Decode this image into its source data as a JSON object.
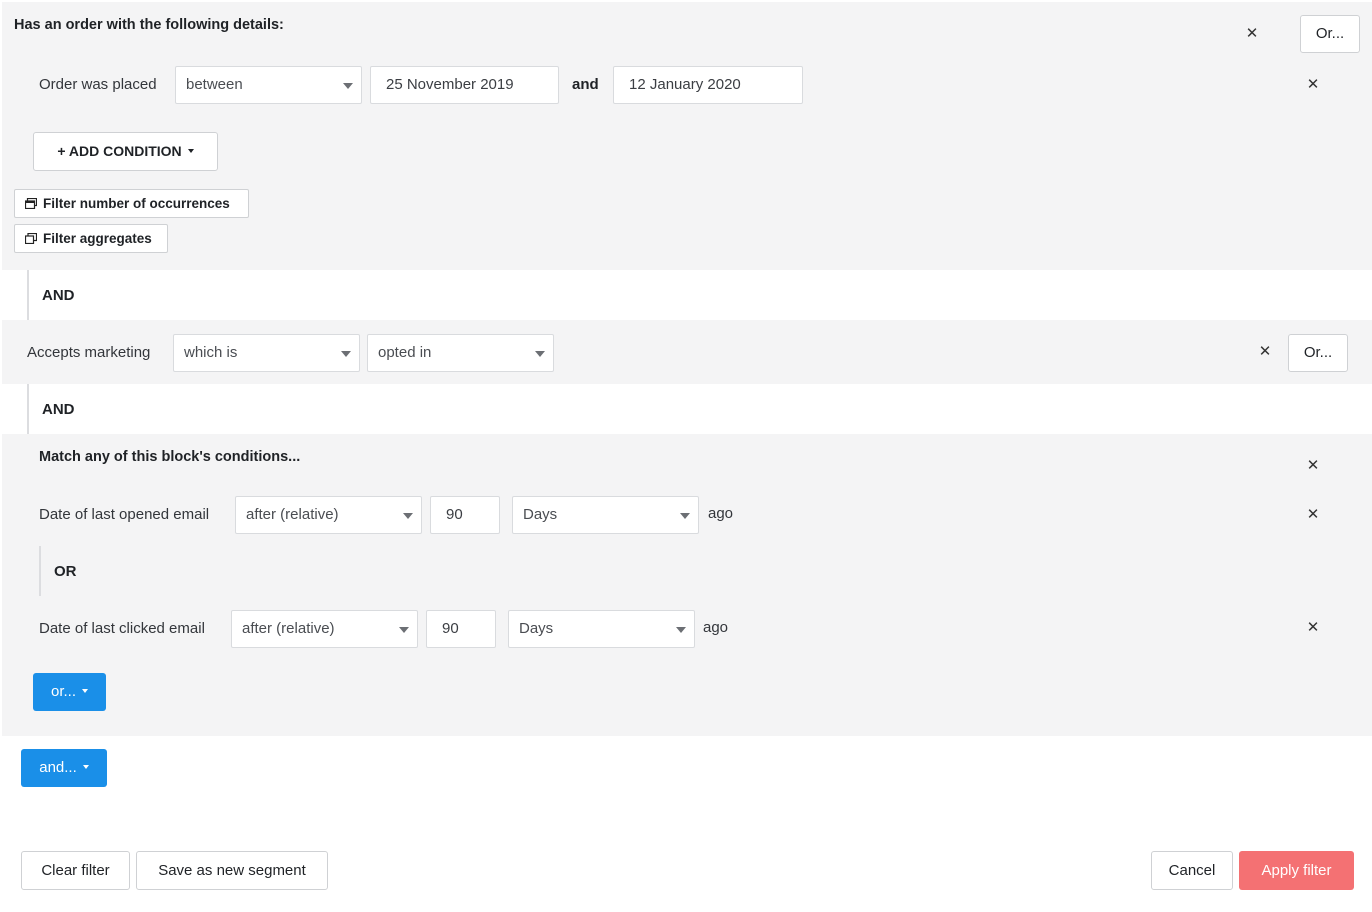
{
  "order_block": {
    "title": "Has an order with the following details:",
    "or_button": "Or...",
    "remove_icon": "close-icon",
    "condition": {
      "label": "Order was placed",
      "operator": "between",
      "start_date": "25 November 2019",
      "joiner": "and",
      "end_date": "12 January 2020"
    },
    "add_condition_label": "+ ADD CONDITION",
    "filter_occurrences_label": "Filter number of occurrences",
    "filter_aggregates_label": "Filter aggregates"
  },
  "and_1": "AND",
  "marketing_block": {
    "label": "Accepts marketing",
    "operator": "which is",
    "value": "opted in",
    "or_button": "Or..."
  },
  "and_2": "AND",
  "match_block": {
    "title": "Match any of this block's conditions...",
    "opened": {
      "label": "Date of last opened email",
      "operator": "after (relative)",
      "amount": "90",
      "unit": "Days",
      "suffix": "ago"
    },
    "or_label": "OR",
    "clicked": {
      "label": "Date of last clicked email",
      "operator": "after (relative)",
      "amount": "90",
      "unit": "Days",
      "suffix": "ago"
    },
    "or_button": "or..."
  },
  "and_button": "and...",
  "footer": {
    "clear": "Clear filter",
    "save": "Save as new segment",
    "cancel": "Cancel",
    "apply": "Apply filter"
  },
  "colors": {
    "primary_blue": "#1a8fe8",
    "apply_red": "#f47173",
    "block_bg": "#f4f4f5"
  }
}
